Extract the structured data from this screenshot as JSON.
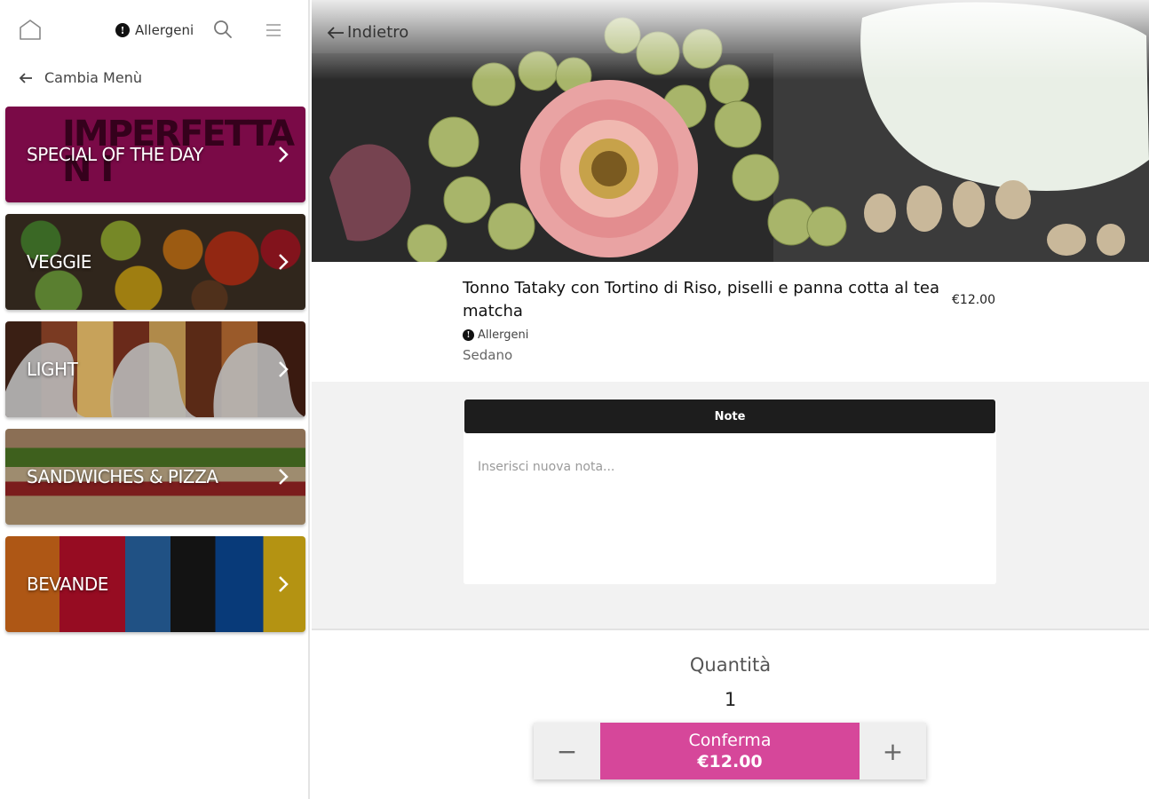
{
  "sidebar": {
    "allergens_label": "Allergeni",
    "change_menu_label": "Cambia Menù",
    "categories": [
      {
        "label": "SPECIAL OF THE DAY",
        "brand_top": "IMPERFETTA",
        "brand_bottom": "N I"
      },
      {
        "label": "VEGGIE"
      },
      {
        "label": "LIGHT"
      },
      {
        "label": "SANDWICHES & PIZZA"
      },
      {
        "label": "BEVANDE"
      }
    ]
  },
  "main": {
    "back_label": "Indietro",
    "product": {
      "name": "Tonno Tataky con Tortino di Riso, piselli e panna cotta al tea matcha",
      "price": "€12.00",
      "allergens_label": "Allergeni",
      "allergens": "Sedano"
    },
    "notes": {
      "header": "Note",
      "placeholder": "Inserisci nuova nota..."
    },
    "quantity": {
      "label": "Quantità",
      "value": "1",
      "minus": "−",
      "plus": "+"
    },
    "confirm": {
      "label": "Conferma",
      "price": "€12.00"
    }
  },
  "colors": {
    "accent": "#d6479a",
    "special_bg": "#7a0a47",
    "notes_header_bg": "#1d1d1d"
  },
  "icons": [
    "home-icon",
    "info-icon",
    "search-icon",
    "hamburger-menu-icon",
    "arrow-left-icon",
    "chevron-right-icon"
  ]
}
